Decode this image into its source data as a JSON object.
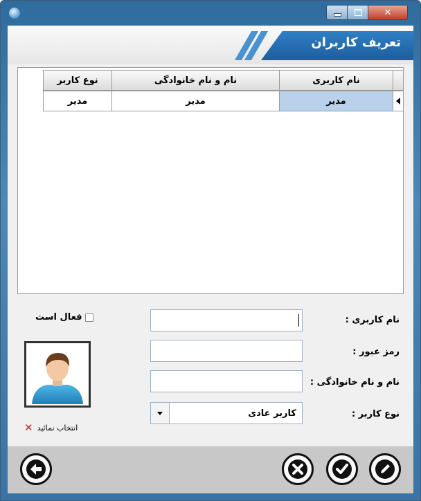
{
  "window": {
    "title": "تعریف کاربران",
    "controls": [
      "minimize",
      "maximize",
      "close"
    ]
  },
  "grid": {
    "columns": [
      "نام کاربری",
      "نام و نام خانوادگی",
      "نوع کاربر"
    ],
    "rows": [
      {
        "username": "مدیر",
        "fullname": "مدیر",
        "usertype": "مدیر",
        "selected": true
      }
    ]
  },
  "form": {
    "username_label": "نام کاربری :",
    "password_label": "رمز عبور :",
    "fullname_label": "نام و نام خانوادگی :",
    "usertype_label": "نوع کاربر :",
    "username_value": "",
    "password_value": "",
    "fullname_value": "",
    "usertype_value": "کاربر عادی",
    "active_label": "فعال است",
    "active_checked": false,
    "choose_photo_label": "انتخاب نمائید"
  },
  "toolbar": {
    "buttons": [
      "back-icon",
      "cancel-icon",
      "confirm-icon",
      "edit-icon"
    ]
  },
  "colors": {
    "banner": "#2f7fc4",
    "selection": "#b9d1ea",
    "toolbar": "#c8c8c8"
  }
}
